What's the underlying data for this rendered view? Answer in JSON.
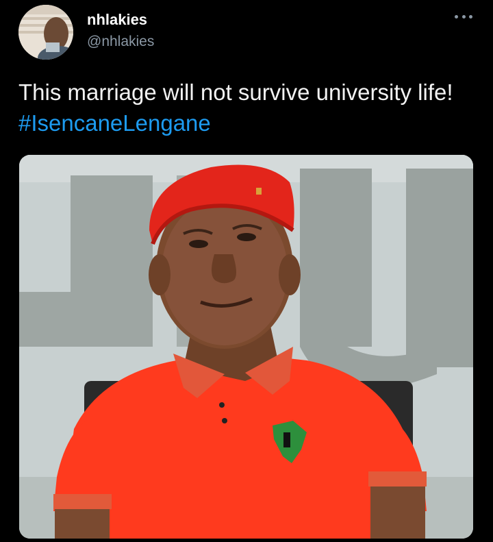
{
  "tweet": {
    "author": {
      "display_name": "nhlakies",
      "handle": "@nhlakies",
      "avatar_icon": "profile-photo"
    },
    "more_icon": "more-horizontal-icon",
    "text": "This marriage will not survive university life!",
    "hashtag": "#IsencaneLengane",
    "media": {
      "type": "photo",
      "icon": "photo-man-red-beret"
    }
  },
  "colors": {
    "background": "#000000",
    "text": "#ffffff",
    "secondary_text": "#8b98a5",
    "link": "#1d9bf0"
  }
}
